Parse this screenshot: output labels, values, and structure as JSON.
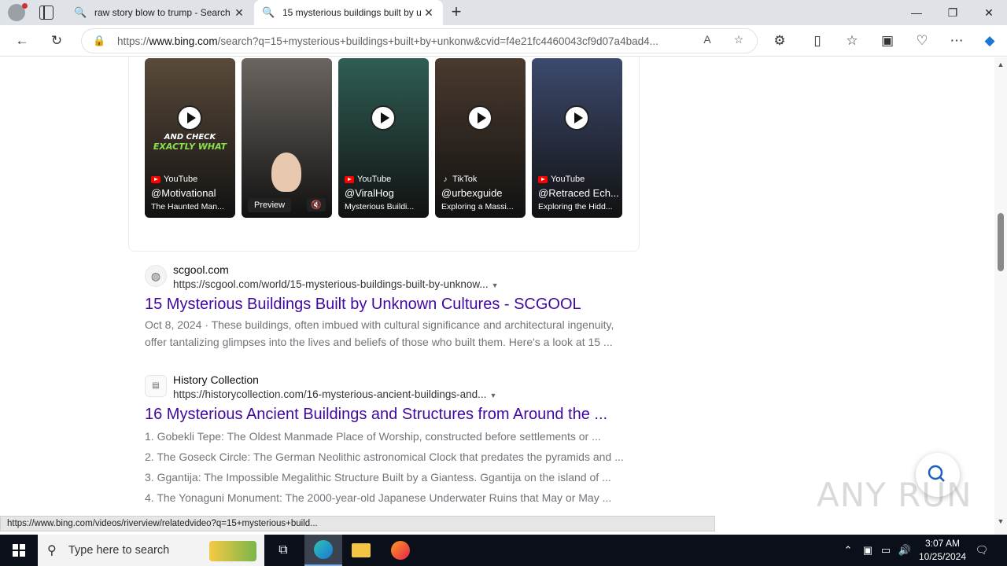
{
  "browser": {
    "tabs": [
      {
        "title": "raw story blow to trump - Search",
        "active": false
      },
      {
        "title": "15 mysterious buildings built by u",
        "active": true
      }
    ],
    "address": {
      "prefix": "https://",
      "domain": "www.bing.com",
      "path": "/search?q=15+mysterious+buildings+built+by+unkonw&cvid=f4e21fc4460043cf9d07a4bad4..."
    },
    "status_url": "https://www.bing.com/videos/riverview/relatedvideo?q=15+mysterious+build..."
  },
  "videos": [
    {
      "source": "YouTube",
      "channel": "@Motivational",
      "desc": "The Haunted Man...",
      "overlay_line1": "AND CHECK",
      "overlay_line2": "EXACTLY WHAT",
      "bg": "#5a4a3a"
    },
    {
      "source": "",
      "channel": "",
      "desc": "",
      "preview_label": "Preview",
      "bg": "#6b6560"
    },
    {
      "source": "YouTube",
      "channel": "@ViralHog",
      "desc": "Mysterious Buildi...",
      "bg": "#2f5e55"
    },
    {
      "source": "TikTok",
      "channel": "@urbexguide",
      "desc": "Exploring a Massi...",
      "bg": "#4a3a2e"
    },
    {
      "source": "YouTube",
      "channel": "@Retraced Ech...",
      "desc": "Exploring the Hidd...",
      "bg": "#3d4a6e"
    }
  ],
  "results": [
    {
      "site": "scgool.com",
      "url": "https://scgool.com/world/15-mysterious-buildings-built-by-unknow...",
      "title": "15 Mysterious Buildings Built by Unknown Cultures - SCGOOL",
      "snippet": "Oct 8, 2024 · These buildings, often imbued with cultural significance and architectural ingenuity, offer tantalizing glimpses into the lives and beliefs of those who built them. Here's a look at 15 ..."
    },
    {
      "site": "History Collection",
      "url": "https://historycollection.com/16-mysterious-ancient-buildings-and...",
      "title": "16 Mysterious Ancient Buildings and Structures from Around the ...",
      "list": [
        "1. Gobekli Tepe: The Oldest Manmade Place of Worship, constructed before settlements or ...",
        "2. The Goseck Circle: The German Neolithic astronomical Clock that predates the pyramids and ...",
        "3. Ggantija: The Impossible Megalithic Structure Built by a Giantess. Ggantija on the island of ...",
        "4. The Yonaguni Monument: The 2000-year-old Japanese Underwater Ruins that May or May ..."
      ]
    }
  ],
  "watermark": "ANY RUN",
  "taskbar": {
    "search_placeholder": "Type here to search",
    "time": "3:07 AM",
    "date": "10/25/2024"
  }
}
